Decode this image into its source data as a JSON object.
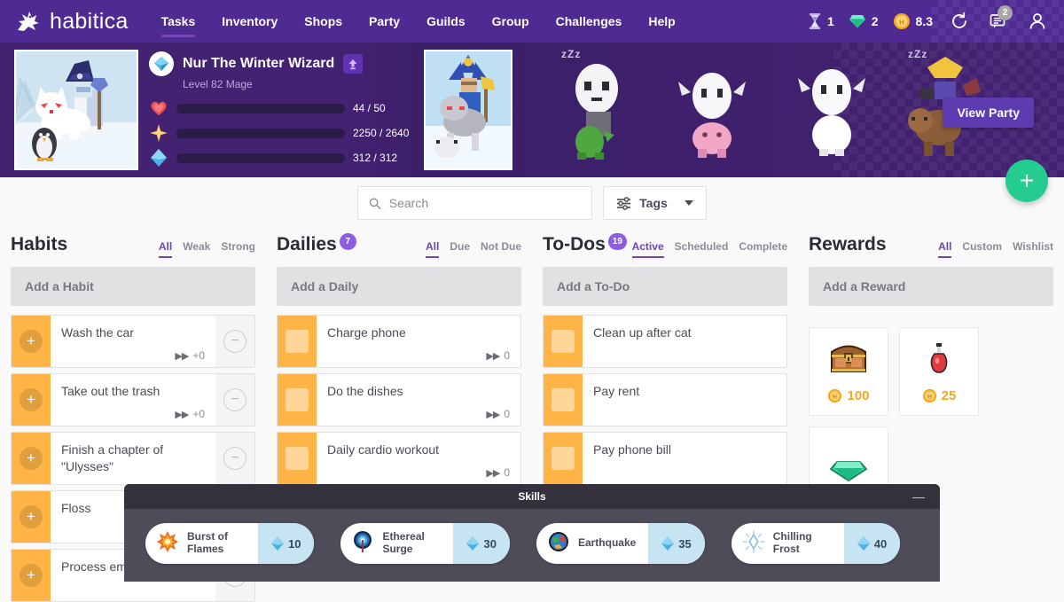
{
  "app": {
    "brand": "habitica",
    "logo_icon": "gryphon-logo-icon"
  },
  "nav": {
    "links": [
      {
        "label": "Tasks",
        "active": true
      },
      {
        "label": "Inventory",
        "active": false
      },
      {
        "label": "Shops",
        "active": false
      },
      {
        "label": "Party",
        "active": false
      },
      {
        "label": "Guilds",
        "active": false
      },
      {
        "label": "Group",
        "active": false
      },
      {
        "label": "Challenges",
        "active": false
      },
      {
        "label": "Help",
        "active": false
      }
    ],
    "currencies": [
      {
        "icon": "hourglass-icon",
        "value": "1"
      },
      {
        "icon": "gem-icon",
        "value": "2"
      },
      {
        "icon": "gold-coin-icon",
        "value": "8.3"
      }
    ],
    "sync_icon": "refresh-icon",
    "messages_icon": "messages-icon",
    "messages_badge": "2",
    "profile_icon": "user-avatar-icon"
  },
  "hero": {
    "avatar_icon": "player-avatar-winter-wizard",
    "character": {
      "name": "Nur The Winter Wizard",
      "subtitle": "Level 82 Mage",
      "class_icon": "mage-class-icon",
      "levelup_icon": "level-up-arrow-icon"
    },
    "bars": [
      {
        "name": "health",
        "icon": "heart-icon",
        "text": "44 / 50",
        "percent": 88,
        "color": "#f74e52"
      },
      {
        "name": "experience",
        "icon": "star-icon",
        "text": "2250 / 2640",
        "percent": 85,
        "color": "#ffbe5d"
      },
      {
        "name": "mana",
        "icon": "mana-diamond-icon",
        "text": "312 / 312",
        "percent": 100,
        "color": "#50b5e9"
      }
    ],
    "party_members": [
      {
        "name": "party-member-self",
        "zzz": "",
        "featured": true
      },
      {
        "name": "party-member-2",
        "zzz": "zZz",
        "featured": false
      },
      {
        "name": "party-member-3",
        "zzz": "",
        "featured": false
      },
      {
        "name": "party-member-4",
        "zzz": "",
        "featured": false
      },
      {
        "name": "party-member-5",
        "zzz": "zZz",
        "featured": false
      }
    ],
    "view_party_label": "View Party",
    "fab_label": "+"
  },
  "search": {
    "placeholder": "Search",
    "value": "",
    "icon": "search-icon"
  },
  "tags": {
    "label": "Tags",
    "icon": "filter-sliders-icon"
  },
  "columns": [
    {
      "key": "habits",
      "title": "Habits",
      "badge": "",
      "filters": [
        {
          "label": "All",
          "active": true
        },
        {
          "label": "Weak",
          "active": false
        },
        {
          "label": "Strong",
          "active": false
        }
      ],
      "add_placeholder": "Add a Habit",
      "type": "habit",
      "tasks": [
        {
          "title": "Wash the car",
          "meta": "+0",
          "meta_icon": "fast-forward-icon"
        },
        {
          "title": "Take out the trash",
          "meta": "+0",
          "meta_icon": "fast-forward-icon"
        },
        {
          "title": "Finish a chapter of \"Ulysses\"",
          "meta": "",
          "meta_icon": ""
        },
        {
          "title": "Floss",
          "meta": "",
          "meta_icon": ""
        },
        {
          "title": "Process email",
          "meta": "",
          "meta_icon": ""
        }
      ]
    },
    {
      "key": "dailies",
      "title": "Dailies",
      "badge": "7",
      "filters": [
        {
          "label": "All",
          "active": true
        },
        {
          "label": "Due",
          "active": false
        },
        {
          "label": "Not Due",
          "active": false
        }
      ],
      "add_placeholder": "Add a Daily",
      "type": "daily",
      "tasks": [
        {
          "title": "Charge phone",
          "meta": "0",
          "meta_icon": "fast-forward-icon",
          "color": "orange"
        },
        {
          "title": "Do the dishes",
          "meta": "0",
          "meta_icon": "fast-forward-icon",
          "color": "orange"
        },
        {
          "title": "Daily cardio workout",
          "meta": "0",
          "meta_icon": "fast-forward-icon",
          "color": "orange"
        },
        {
          "title": "",
          "meta": "",
          "meta_icon": "",
          "color": "orange"
        }
      ]
    },
    {
      "key": "todos",
      "title": "To-Dos",
      "badge": "19",
      "filters": [
        {
          "label": "Active",
          "active": true
        },
        {
          "label": "Scheduled",
          "active": false
        },
        {
          "label": "Complete",
          "active": false
        }
      ],
      "add_placeholder": "Add a To-Do",
      "type": "todo",
      "tasks": [
        {
          "title": "Clean up after cat",
          "meta": "",
          "meta_icon": "",
          "color": "orange"
        },
        {
          "title": "Pay rent",
          "meta": "",
          "meta_icon": "",
          "color": "orange"
        },
        {
          "title": "Pay phone bill",
          "meta": "",
          "meta_icon": "",
          "color": "orange"
        },
        {
          "title": "",
          "meta": "",
          "meta_icon": "",
          "color": "red"
        }
      ]
    },
    {
      "key": "rewards",
      "title": "Rewards",
      "badge": "",
      "filters": [
        {
          "label": "All",
          "active": true
        },
        {
          "label": "Custom",
          "active": false
        },
        {
          "label": "Wishlist",
          "active": false
        }
      ],
      "add_placeholder": "Add a Reward",
      "type": "reward",
      "rewards": [
        {
          "icon": "treasure-chest-icon",
          "price": "100"
        },
        {
          "icon": "health-potion-icon",
          "price": "25"
        },
        {
          "icon": "gem-reward-icon",
          "price": ""
        }
      ]
    }
  ],
  "skills": {
    "title": "Skills",
    "minimize_label": "—",
    "items": [
      {
        "name": "Burst of Flames",
        "cost": "10",
        "icon": "burst-of-flames-icon"
      },
      {
        "name": "Ethereal Surge",
        "cost": "30",
        "icon": "ethereal-surge-icon"
      },
      {
        "name": "Earthquake",
        "cost": "35",
        "icon": "earthquake-icon"
      },
      {
        "name": "Chilling Frost",
        "cost": "40",
        "icon": "chilling-frost-icon"
      }
    ]
  },
  "colors": {
    "brand_purple": "#4f2a93",
    "accent_purple": "#6d44ba",
    "task_orange": "#ffb445",
    "task_red": "#e8484d",
    "gold": "#f5a623",
    "mana_blue": "#50b5e9",
    "fab_green": "#24cc8f"
  }
}
